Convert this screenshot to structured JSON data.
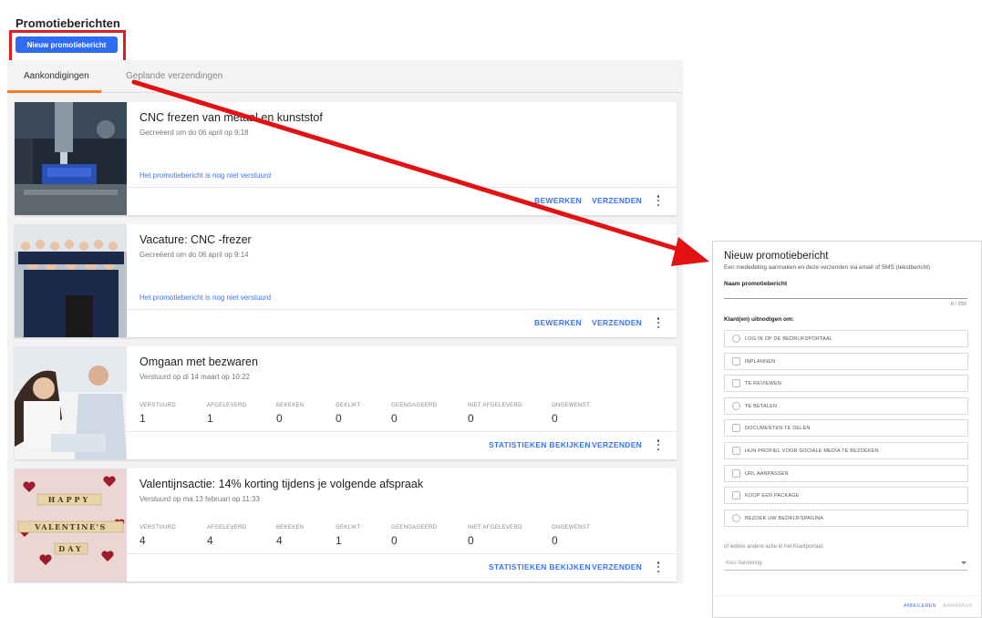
{
  "page": {
    "title": "Promotieberichten",
    "new_button": "Nieuw promotiebericht",
    "tabs": [
      "Aankondigingen",
      "Geplande verzendingen"
    ]
  },
  "stat_labels": [
    "VERSTUURD",
    "AFGELEVERD",
    "BEKEKEN",
    "GEKLIKT",
    "GEENGAGEERD",
    "NIET AFGELEVERD",
    "ONGEWENST"
  ],
  "cards": [
    {
      "title": "CNC frezen van metaal en kunststof",
      "subtitle": "Gecreëerd om do 06 april op 9:18",
      "status": "Het promotiebericht is nog niet verstuurd",
      "actions": [
        "BEWERKEN",
        "VERZENDEN"
      ]
    },
    {
      "title": "Vacature: CNC -frezer",
      "subtitle": "Gecreëerd om do 06 april op 9:14",
      "status": "Het promotiebericht is nog niet verstuurd",
      "actions": [
        "BEWERKEN",
        "VERZENDEN"
      ]
    },
    {
      "title": "Omgaan met bezwaren",
      "subtitle": "Verstuurd op di 14 maart op 10:22",
      "stats": [
        "1",
        "1",
        "0",
        "0",
        "0",
        "0",
        "0"
      ],
      "actions": [
        "STATISTIEKEN BEKIJKEN",
        "VERZENDEN"
      ]
    },
    {
      "title": "Valentijnsactie: 14% korting tijdens je volgende afspraak",
      "subtitle": "Verstuurd op ma 13 februari op 11:33",
      "stats": [
        "4",
        "4",
        "4",
        "1",
        "0",
        "0",
        "0"
      ],
      "actions": [
        "STATISTIEKEN BEKIJKEN",
        "VERZENDEN"
      ],
      "tile_text": [
        "HAPPY",
        "VALENTINE'S",
        "DAY"
      ]
    }
  ],
  "modal": {
    "title": "Nieuw promotiebericht",
    "subtitle": "Een mededeling aanmaken en deze verzenden via email of SMS (tekstbericht)",
    "name_label": "Naam promotiebericht",
    "char_count": "0 / 250",
    "invite_label": "Klant(en) uitnodigen om:",
    "options": [
      {
        "label": "LOG IN OP DE BEDRIJFSPORTAAL",
        "icon": "user-icon"
      },
      {
        "label": "INPLANNEN",
        "icon": "calendar-icon"
      },
      {
        "label": "TE REVIEWEN",
        "icon": "star-icon"
      },
      {
        "label": "TE BETALEN",
        "icon": "coins-icon"
      },
      {
        "label": "DOCUMENTEN TE DELEN",
        "icon": "document-icon"
      },
      {
        "label": "HUN PROFIEL VOOR SOCIALE MEDIA TE BEZOEKEN",
        "icon": "share-icon"
      },
      {
        "label": "URL AANPASSEN",
        "icon": "link-icon"
      },
      {
        "label": "KOOP EEN PACKAGE",
        "icon": "package-icon"
      },
      {
        "label": "BEZOEK UW BEDRIJFSPAGINA",
        "icon": "globe-icon"
      }
    ],
    "or_text": "of iedere andere actie in het Klantportaal:",
    "select_placeholder": "Kies handeling:",
    "cancel": "ANNULEREN",
    "create": "AANMAKEN"
  },
  "colors": {
    "accent_blue": "#2e6cf4",
    "link_blue": "#3a74f0",
    "highlight_red": "#e11d1d",
    "tab_orange": "#f47b2a"
  }
}
